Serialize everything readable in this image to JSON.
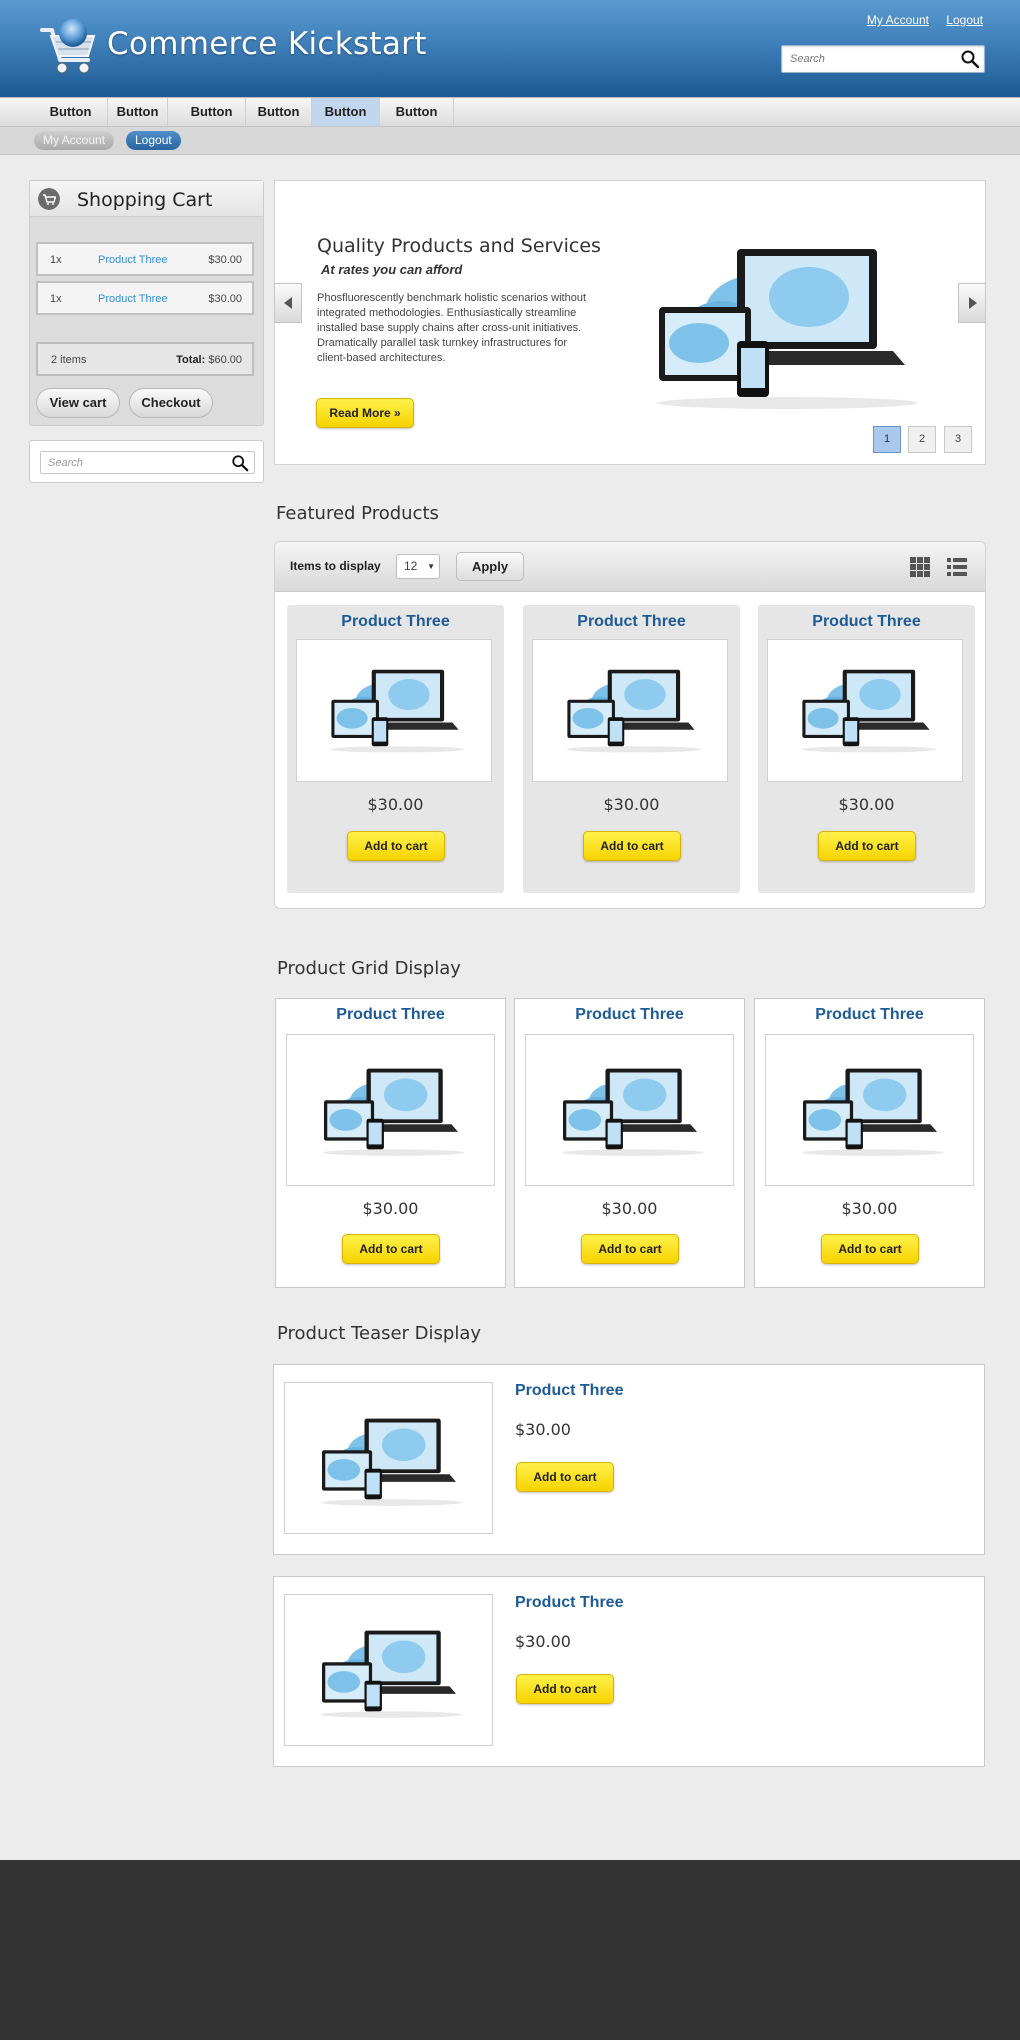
{
  "header": {
    "site_name": "Commerce Kickstart",
    "links": {
      "my_account": "My Account",
      "logout": "Logout"
    },
    "search_placeholder": "Search"
  },
  "main_menu": [
    "Button",
    "Button",
    "Button",
    "Button",
    "Button",
    "Button"
  ],
  "main_menu_active_index": 4,
  "user_menu": {
    "my_account": "My Account",
    "logout": "Logout"
  },
  "cart": {
    "title": "Shopping Cart",
    "lines": [
      {
        "qty": "1x",
        "name": "Product Three",
        "price": "$30.00"
      },
      {
        "qty": "1x",
        "name": "Product Three",
        "price": "$30.00"
      }
    ],
    "items_count": "2 items",
    "total_label": "Total:",
    "total_value": "$60.00",
    "view_cart": "View cart",
    "checkout": "Checkout"
  },
  "sidebar_search": {
    "placeholder": "Search"
  },
  "slider": {
    "title": "Quality Products and Services",
    "subtitle": "At rates you can afford",
    "body": "Phosfluorescently benchmark holistic scenarios without integrated methodologies. Enthusiastically streamline installed base supply chains after cross-unit initiatives. Dramatically parallel task turnkey infrastructures for client-based architectures.",
    "cta": "Read More »",
    "pages": [
      "1",
      "2",
      "3"
    ],
    "active_page": "1"
  },
  "featured": {
    "heading": "Featured Products",
    "items_label": "Items to display",
    "items_value": "12",
    "apply": "Apply",
    "products": [
      {
        "name": "Product Three",
        "price": "$30.00",
        "button": "Add to cart"
      },
      {
        "name": "Product Three",
        "price": "$30.00",
        "button": "Add to cart"
      },
      {
        "name": "Product Three",
        "price": "$30.00",
        "button": "Add to cart"
      }
    ]
  },
  "grid_display": {
    "heading": "Product Grid Display",
    "products": [
      {
        "name": "Product Three",
        "price": "$30.00",
        "button": "Add to cart"
      },
      {
        "name": "Product Three",
        "price": "$30.00",
        "button": "Add to cart"
      },
      {
        "name": "Product Three",
        "price": "$30.00",
        "button": "Add to cart"
      }
    ]
  },
  "teaser_display": {
    "heading": "Product Teaser Display",
    "products": [
      {
        "name": "Product Three",
        "price": "$30.00",
        "button": "Add to cart"
      },
      {
        "name": "Product Three",
        "price": "$30.00",
        "button": "Add to cart"
      }
    ]
  },
  "colors": {
    "header_blue": "#3f7fb9",
    "product_title": "#1e5b96",
    "cart_link": "#2f8fd6",
    "button_yellow": "#f7d300",
    "footer": "#333333"
  },
  "icons": [
    "shopping-cart-logo-icon",
    "search-icon",
    "cart-icon",
    "arrow-left-icon",
    "arrow-right-icon",
    "grid-view-icon",
    "list-view-icon",
    "product-devices-image"
  ]
}
